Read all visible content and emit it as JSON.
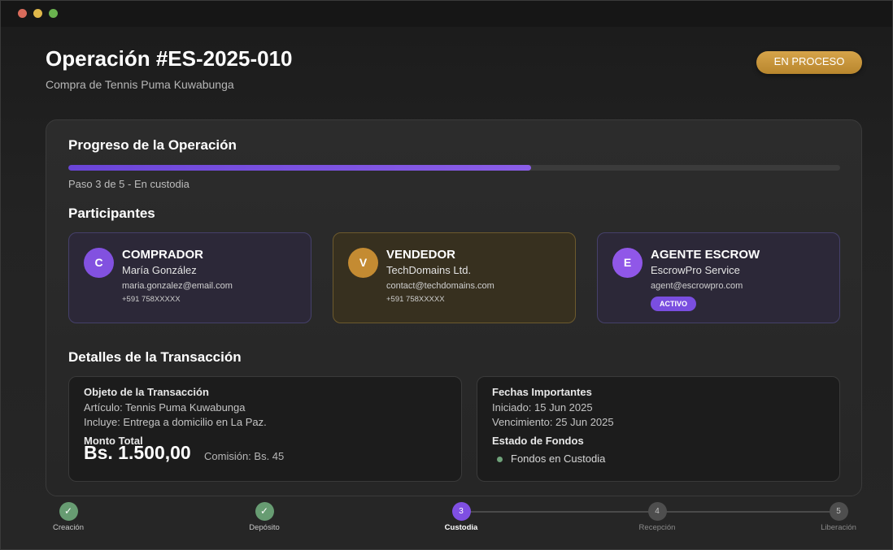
{
  "window": {
    "controls": [
      "close",
      "minimize",
      "maximize"
    ]
  },
  "header": {
    "title": "Operación #ES-2025-010",
    "subtitle": "Compra de Tennis Puma Kuwabunga",
    "status": "EN PROCESO"
  },
  "progress": {
    "title": "Progreso de la Operación",
    "value": 0.6,
    "text": "Paso 3 de 5 - En custodia"
  },
  "participants": {
    "title": "Participantes",
    "buyer": {
      "initial": "C",
      "role": "COMPRADOR",
      "name": "María González",
      "email": "maria.gonzalez@email.com",
      "phone": "+591 758XXXXX"
    },
    "seller": {
      "initial": "V",
      "role": "VENDEDOR",
      "name": "TechDomains Ltd.",
      "email": "contact@techdomains.com",
      "phone": "+591 758XXXXX"
    },
    "agent": {
      "initial": "E",
      "role": "AGENTE ESCROW",
      "name": "EscrowPro Service",
      "email": "agent@escrowpro.com",
      "badge": "ACTIVO"
    }
  },
  "details": {
    "title": "Detalles de la Transacción",
    "object": {
      "heading": "Objeto de la Transacción",
      "article": "Artículo: Tennis Puma Kuwabunga",
      "includes": "Incluye: Entrega a domicilio en La Paz.",
      "amount_label": "Monto Total",
      "amount": "Bs. 1.500,00",
      "commission": "Comisión: Bs. 45"
    },
    "dates": {
      "heading": "Fechas Importantes",
      "started": "Iniciado: 15 Jun 2025",
      "due": "Vencimiento: 25 Jun 2025",
      "funds_heading": "Estado de Fondos",
      "funds_status": "Fondos en Custodia"
    }
  },
  "steps": [
    {
      "label": "Creación",
      "marker": "✓",
      "state": "done"
    },
    {
      "label": "Depósito",
      "marker": "✓",
      "state": "done"
    },
    {
      "label": "Custodia",
      "marker": "3",
      "state": "current"
    },
    {
      "label": "Recepción",
      "marker": "4",
      "state": "pending"
    },
    {
      "label": "Liberación",
      "marker": "5",
      "state": "pending"
    }
  ],
  "colors": {
    "accent": "#7f4fe2",
    "gold": "#c48b32",
    "success": "#679c72"
  }
}
